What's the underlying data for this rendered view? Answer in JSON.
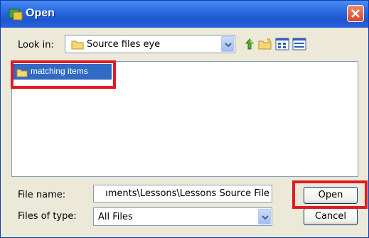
{
  "window": {
    "title": "Open"
  },
  "look_in": {
    "label": "Look in:",
    "value": "Source files eye"
  },
  "files": [
    {
      "name": "matching items",
      "type": "folder",
      "selected": true
    }
  ],
  "file_name": {
    "label": "File name:",
    "value": "ıments\\Lessons\\Lessons Source File"
  },
  "files_of_type": {
    "label": "Files of type:",
    "value": "All Files"
  },
  "buttons": {
    "open": "Open",
    "cancel": "Cancel"
  },
  "colors": {
    "title_bar": "#2d6ee6",
    "selection": "#316ac5",
    "highlight_box": "#e01b24",
    "close_button": "#d4472a"
  }
}
